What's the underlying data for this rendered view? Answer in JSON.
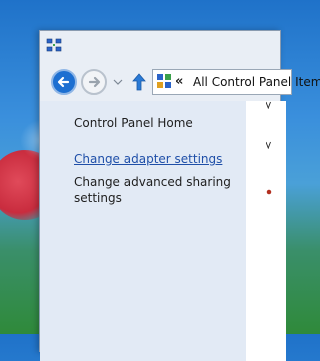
{
  "window": {
    "title_icon": "network-sharing-icon"
  },
  "navigation": {
    "back_icon": "back-arrow-icon",
    "forward_icon": "forward-arrow-icon",
    "recent_icon": "chevron-down-icon",
    "up_icon": "up-arrow-icon"
  },
  "address_bar": {
    "icon": "control-panel-icon",
    "chevron": "«",
    "path_text": "All Control Panel Items"
  },
  "sidebar": {
    "home_label": "Control Panel Home",
    "adapter_label": "Change adapter settings",
    "sharing_label": "Change advanced sharing settings"
  },
  "colors": {
    "link": "#1f4fa8",
    "back_button": "#1d6fd1",
    "sidebar_bg": "#e2eaf5"
  }
}
